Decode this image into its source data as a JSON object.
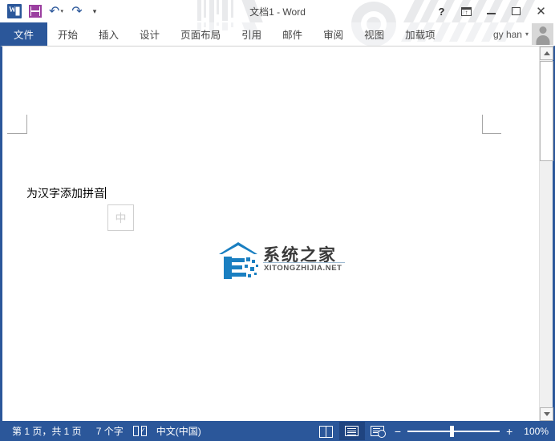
{
  "window": {
    "title": "文档1 - Word",
    "quick_access": [
      {
        "name": "word-app-icon",
        "label": "W"
      },
      {
        "name": "save-icon",
        "label": "保存"
      },
      {
        "name": "undo-icon",
        "label": "撤销"
      },
      {
        "name": "redo-icon",
        "label": "恢复"
      },
      {
        "name": "customize-qat-icon",
        "label": "自定义快速访问工具栏"
      }
    ],
    "controls": {
      "help": "?",
      "ribbon_display": "功能区显示选项",
      "minimize": "最小化",
      "maximize": "最大化",
      "close": "关闭"
    }
  },
  "ribbon": {
    "tabs": [
      {
        "label": "文件",
        "active": true
      },
      {
        "label": "开始",
        "active": false
      },
      {
        "label": "插入",
        "active": false
      },
      {
        "label": "设计",
        "active": false
      },
      {
        "label": "页面布局",
        "active": false
      },
      {
        "label": "引用",
        "active": false
      },
      {
        "label": "邮件",
        "active": false
      },
      {
        "label": "审阅",
        "active": false
      },
      {
        "label": "视图",
        "active": false
      },
      {
        "label": "加载项",
        "active": false
      }
    ],
    "account": {
      "name": "gy han",
      "caret": "▾"
    }
  },
  "document": {
    "body_text": "为汉字添加拼音",
    "ime_indicator": "中",
    "watermark": {
      "cn": "系统之家",
      "en": "XITONGZHIJIA.NET"
    }
  },
  "statusbar": {
    "page_info": "第 1 页，共 1 页",
    "word_count": "7 个字",
    "proofing_icon": "proofing-errors-icon",
    "language": "中文(中国)",
    "views": [
      {
        "name": "read-mode-view",
        "label": "阅读视图",
        "active": false
      },
      {
        "name": "print-layout-view",
        "label": "页面视图",
        "active": true
      },
      {
        "name": "web-layout-view",
        "label": "Web 版式视图",
        "active": false
      }
    ],
    "zoom": {
      "minus": "−",
      "plus": "+",
      "level": "100%",
      "value": 100
    }
  },
  "colors": {
    "accent": "#2b579a",
    "statusbar": "#2b579a",
    "tab_active_bg": "#2b579a",
    "save_icon": "#9b3fa0",
    "logo_blue": "#1a7fc1"
  }
}
